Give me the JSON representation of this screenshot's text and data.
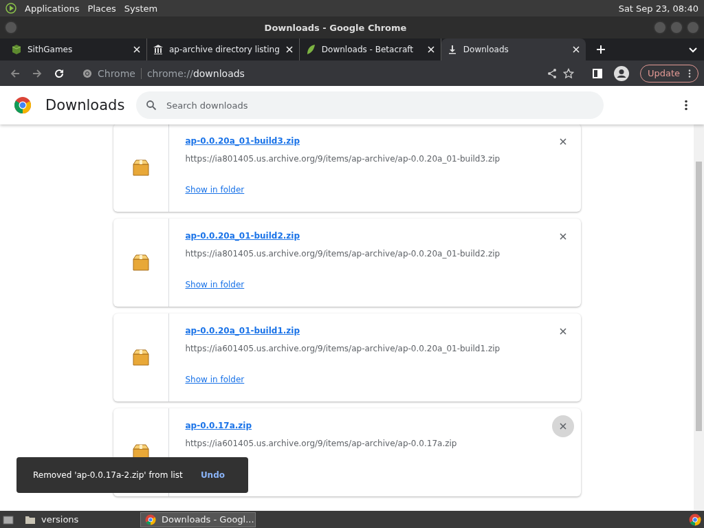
{
  "top_panel": {
    "menus": [
      "Applications",
      "Places",
      "System"
    ],
    "clock": "Sat Sep 23, 08:40"
  },
  "window": {
    "title": "Downloads - Google Chrome"
  },
  "tabs": [
    {
      "label": "SithGames",
      "selected": false
    },
    {
      "label": "ap-archive directory listing",
      "selected": false
    },
    {
      "label": "Downloads - Betacraft",
      "selected": false
    },
    {
      "label": "Downloads",
      "selected": true
    }
  ],
  "address_bar": {
    "site": "Chrome",
    "url_prefix": "chrome://",
    "url_host": "downloads"
  },
  "update_button": "Update",
  "page": {
    "title": "Downloads",
    "search": {
      "placeholder": "Search downloads"
    }
  },
  "downloads": [
    {
      "filename": "ap-0.0.20a_01-build3.zip",
      "url": "https://ia801405.us.archive.org/9/items/ap-archive/ap-0.0.20a_01-build3.zip",
      "action": "Show in folder",
      "hovered": false
    },
    {
      "filename": "ap-0.0.20a_01-build2.zip",
      "url": "https://ia801405.us.archive.org/9/items/ap-archive/ap-0.0.20a_01-build2.zip",
      "action": "Show in folder",
      "hovered": false
    },
    {
      "filename": "ap-0.0.20a_01-build1.zip",
      "url": "https://ia601405.us.archive.org/9/items/ap-archive/ap-0.0.20a_01-build1.zip",
      "action": "Show in folder",
      "hovered": false
    },
    {
      "filename": "ap-0.0.17a.zip",
      "url": "https://ia601405.us.archive.org/9/items/ap-archive/ap-0.0.17a.zip",
      "hovered": true
    }
  ],
  "toast": {
    "message": "Removed 'ap-0.0.17a-2.zip' from list",
    "action": "Undo"
  },
  "taskbar": {
    "items": [
      {
        "label": "versions",
        "selected": false
      },
      {
        "label": "Downloads - Googl...",
        "selected": true
      }
    ]
  }
}
